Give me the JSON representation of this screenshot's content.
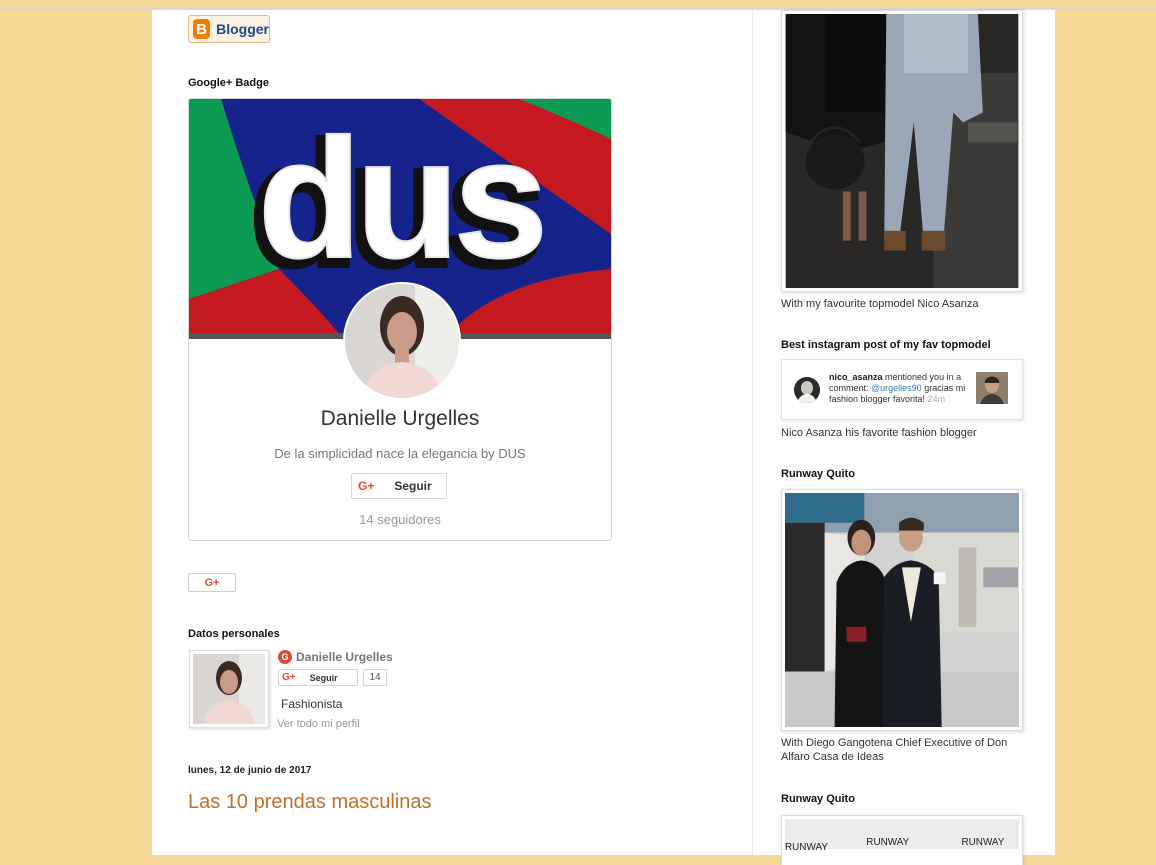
{
  "blogger_button": {
    "label": "Blogger",
    "logo_letter": "B"
  },
  "gplus_badge": {
    "title": "Google+ Badge",
    "cover_text": "DUS",
    "name": "Danielle Urgelles",
    "tagline": "De la simplicidad nace la elegancia by DUS",
    "follow_icon": "G+",
    "follow_label": "Seguir",
    "followers": "14 seguidores"
  },
  "gplus_button": {
    "label": "G+"
  },
  "profile": {
    "title": "Datos personales",
    "g_icon": "G",
    "name": "Danielle Urgelles",
    "follow_icon": "G+",
    "follow_label": "Seguir",
    "follow_count": "14",
    "occupation": "Fashionista",
    "view_profile": "Ver todo mi perfil"
  },
  "post": {
    "date": "lunes, 12 de junio de 2017",
    "title": "Las 10 prendas masculinas"
  },
  "sidebar": {
    "photo1_caption": "With my favourite topmodel Nico Asanza",
    "insta_title": "Best instagram post of my fav topmodel",
    "insta": {
      "user": "nico_asanza",
      "text1": " mentioned you in a comment: ",
      "mention": "@urgelles90",
      "text2": " gracias mi fashion blogger favorita! ",
      "time": "24m"
    },
    "insta_caption": "Nico Asanza his favorite fashion blogger",
    "runway1_title": "Runway Quito",
    "runway1_caption": "With Diego Gangotena Chief Executive of Don Alfaro Casa de Ideas",
    "runway2_title": "Runway Quito",
    "runway_banner": [
      "RUNWAY",
      "RUNWAY",
      "RUNWAY"
    ]
  },
  "colors": {
    "page_bg": "#f6da96",
    "post_title": "#c0702a",
    "gplus_red": "#dd4b39",
    "blogger_orange": "#f57d00"
  }
}
